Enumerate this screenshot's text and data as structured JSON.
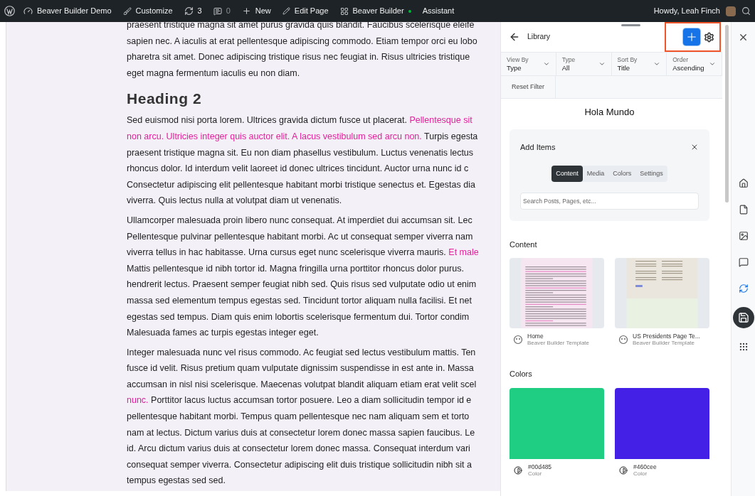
{
  "admin_bar": {
    "site": "Beaver Builder Demo",
    "customize": "Customize",
    "updates": "3",
    "comments": "0",
    "new": "New",
    "edit_page": "Edit Page",
    "builder": {
      "label": "Beaver Builder",
      "active": true
    },
    "assistant": "Assistant",
    "greeting": "Howdy, Leah Finch"
  },
  "page": {
    "blocks": [
      {
        "kind": "paragraph",
        "lines": [
          [
            {
              "text": "praesent tristique magna sit amet purus gravida quis blandit. Faucibus scelerisque eleife",
              "link": false
            }
          ],
          [
            {
              "text": "sapien nec. A iaculis at erat pellentesque adipiscing commodo. Etiam tempor orci eu lobo",
              "link": false
            }
          ],
          [
            {
              "text": "pharetra sit amet. Donec adipiscing tristique risus nec feugiat in. Risus ultricies tristique",
              "link": false
            }
          ],
          [
            {
              "text": "eget magna fermentum iaculis eu non diam.",
              "link": false
            }
          ]
        ]
      },
      {
        "kind": "heading",
        "text": "Heading 2"
      },
      {
        "kind": "paragraph",
        "lines": [
          [
            {
              "text": "Sed euismod nisi porta lorem. Ultrices gravida dictum fusce ut placerat. ",
              "link": false
            },
            {
              "text": "Pellentesque sit",
              "link": true
            }
          ],
          [
            {
              "text": "non arcu. Ultricies integer quis auctor elit. A lacus vestibulum sed arcu non.",
              "link": true
            },
            {
              "text": " Turpis egesta",
              "link": false
            }
          ],
          [
            {
              "text": "praesent tristique magna sit. Eu non diam phasellus vestibulum. Luctus venenatis lectus",
              "link": false
            }
          ],
          [
            {
              "text": "rhoncus dolor. Id interdum velit laoreet id donec ultrices tincidunt. Auctor urna nunc id c",
              "link": false
            }
          ],
          [
            {
              "text": "Consectetur adipiscing elit pellentesque habitant morbi tristique senectus et. Egestas dia",
              "link": false
            }
          ],
          [
            {
              "text": "viverra. Quis lectus nulla at volutpat diam ut venenatis.",
              "link": false
            }
          ]
        ]
      },
      {
        "kind": "paragraph",
        "lines": [
          [
            {
              "text": "Ullamcorper malesuada proin libero nunc consequat. At imperdiet dui accumsan sit. Lec",
              "link": false
            }
          ],
          [
            {
              "text": "Pellentesque pulvinar pellentesque habitant morbi. Ac ut consequat semper viverra nam",
              "link": false
            }
          ],
          [
            {
              "text": "viverra tellus in hac habitasse. Urna cursus eget nunc scelerisque viverra mauris. ",
              "link": false
            },
            {
              "text": "Et male",
              "link": true
            }
          ],
          [
            {
              "text": "Mattis pellentesque id nibh tortor id. Magna fringilla urna porttitor rhoncus dolor purus.",
              "link": false
            }
          ],
          [
            {
              "text": "hendrerit lectus. Praesent semper feugiat nibh sed. Quis risus sed vulputate odio ut enim",
              "link": false
            }
          ],
          [
            {
              "text": "massa sed elementum tempus egestas sed. Tincidunt tortor aliquam nulla facilisi. Et net",
              "link": false
            }
          ],
          [
            {
              "text": "egestas sed tempus. Diam quis enim lobortis scelerisque fermentum dui. Tortor condim",
              "link": false
            }
          ],
          [
            {
              "text": "Malesuada fames ac turpis egestas integer eget.",
              "link": false
            }
          ]
        ]
      },
      {
        "kind": "paragraph",
        "lines": [
          [
            {
              "text": "Integer malesuada nunc vel risus commodo. Ac feugiat sed lectus vestibulum mattis. Ten",
              "link": false
            }
          ],
          [
            {
              "text": "fusce id velit. Risus pretium quam vulputate dignissim suspendisse in est ante in. Massa",
              "link": false
            }
          ],
          [
            {
              "text": "accumsan in nisl nisi scelerisque. Maecenas volutpat blandit aliquam etiam erat velit scel",
              "link": false
            }
          ],
          [
            {
              "text": "nunc.",
              "link": true
            },
            {
              "text": " Porttitor lacus luctus accumsan tortor posuere. Leo a diam sollicitudin tempor id e",
              "link": false
            }
          ],
          [
            {
              "text": "pellentesque habitant morbi. Tempus quam pellentesque nec nam aliquam sem et torto",
              "link": false
            }
          ],
          [
            {
              "text": "nam at lectus. Dictum varius duis at consectetur lorem donec massa sapien faucibus. Le",
              "link": false
            }
          ],
          [
            {
              "text": "id. Arcu dictum varius duis at consectetur lorem donec massa. Consequat interdum vari",
              "link": false
            }
          ],
          [
            {
              "text": "consequat semper viverra. Consectetur adipiscing elit duis tristique sollicitudin nibh sit a",
              "link": false
            }
          ],
          [
            {
              "text": "tempus egestas sed sed.",
              "link": false
            }
          ]
        ]
      }
    ]
  },
  "library": {
    "title": "Library",
    "add_highlighted": true,
    "filters": [
      {
        "label": "View By",
        "value": "Type"
      },
      {
        "label": "Type",
        "value": "All"
      },
      {
        "label": "Sort By",
        "value": "Title"
      },
      {
        "label": "Order",
        "value": "Ascending"
      }
    ],
    "reset": "Reset Filter",
    "heading": "Hola Mundo",
    "add_items": {
      "title": "Add Items",
      "tabs": [
        {
          "label": "Content",
          "selected": true
        },
        {
          "label": "Media",
          "selected": false
        },
        {
          "label": "Colors",
          "selected": false
        },
        {
          "label": "Settings",
          "selected": false
        }
      ],
      "search": {
        "placeholder": "Search Posts, Pages, etc..."
      }
    },
    "content": {
      "title": "Content",
      "items": [
        {
          "name": "Home",
          "type": "Beaver Builder Template"
        },
        {
          "name": "US Presidents Page Te...",
          "type": "Beaver Builder Template"
        }
      ]
    },
    "colors": {
      "title": "Colors",
      "items": [
        {
          "name": "#00d485",
          "type": "Color",
          "color": "#1fce82"
        },
        {
          "name": "#460cee",
          "type": "Color",
          "color": "#4420e6"
        }
      ]
    }
  },
  "rail": [
    {
      "kind": "home",
      "selected": false
    },
    {
      "kind": "file",
      "selected": false
    },
    {
      "kind": "image",
      "selected": false
    },
    {
      "kind": "comment",
      "selected": false
    },
    {
      "kind": "sync",
      "selected": false
    },
    {
      "kind": "save",
      "selected": true
    },
    {
      "kind": "apps",
      "selected": false
    }
  ]
}
